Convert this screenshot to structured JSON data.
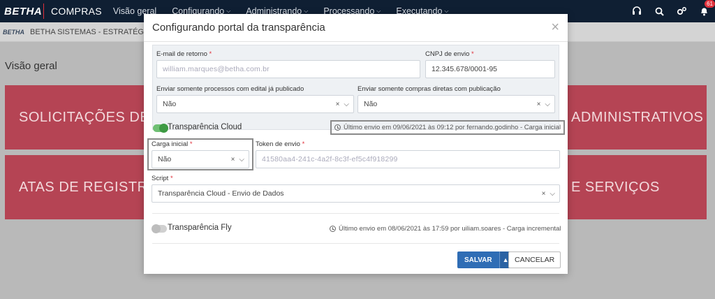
{
  "topnav": {
    "logo": "BETHA",
    "app_name": "COMPRAS",
    "items": [
      "Visão geral",
      "Configurando",
      "Administrando",
      "Processando",
      "Executando"
    ],
    "notification_count": "61"
  },
  "subbar": {
    "logo": "BETHA",
    "title": "BETHA SISTEMAS - ESTRATÉGIA D"
  },
  "page": {
    "title": "Visão geral",
    "tiles": [
      "SOLICITAÇÕES DE C",
      "ADMINISTRATIVOS",
      "ATAS DE REGISTROS",
      "E SERVIÇOS"
    ]
  },
  "modal": {
    "title": "Configurando portal da transparência",
    "email": {
      "label": "E-mail de retorno",
      "value": "william.marques@betha.com.br"
    },
    "cnpj": {
      "label": "CNPJ de envio",
      "value": "12.345.678/0001-95"
    },
    "edital": {
      "label": "Enviar somente processos com edital já publicado",
      "value": "Não"
    },
    "compras": {
      "label": "Enviar somente compras diretas com publicação",
      "value": "Não"
    },
    "cloud": {
      "label": "Transparência Cloud",
      "enabled": true,
      "last_send": "Último envio em 09/06/2021 às 09:12 por fernando.godinho - Carga inicial"
    },
    "carga": {
      "label": "Carga inicial",
      "value": "Não"
    },
    "token": {
      "label": "Token de envio",
      "value": "41580aa4-241c-4a2f-8c3f-ef5c4f918299"
    },
    "script": {
      "label": "Script",
      "value": "Transparência Cloud - Envio de Dados"
    },
    "fly": {
      "label": "Transparência Fly",
      "enabled": false,
      "last_send": "Último envio em 08/06/2021 às 17:59 por uiliam.soares - Carga incremental"
    },
    "save_label": "SALVAR",
    "cancel_label": "CANCELAR",
    "required_mark": "*",
    "clear_glyph": "×",
    "close_glyph": "×"
  },
  "colors": {
    "navbar": "#0f1f33",
    "accent_red": "#e0303a",
    "tile": "#b54454",
    "primary_button": "#2f6db5",
    "toggle_on": "#3e9a44"
  }
}
